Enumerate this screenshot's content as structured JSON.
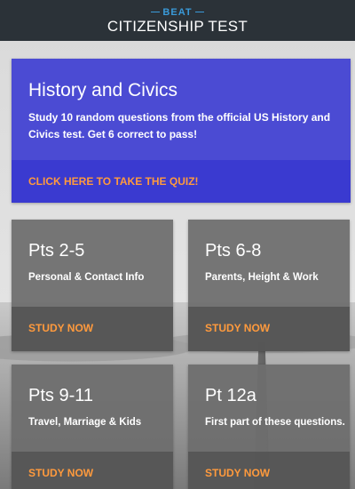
{
  "header": {
    "brand": "BEAT",
    "title": "CITIZENSHIP TEST"
  },
  "hero": {
    "title": "History and Civics",
    "description": "Study 10 random questions from the official US History and Civics test. Get 6 correct to pass!",
    "action": "CLICK HERE TO TAKE THE QUIZ!"
  },
  "cards": [
    {
      "title": "Pts 2-5",
      "subtitle": "Personal & Contact Info",
      "action": "STUDY NOW"
    },
    {
      "title": "Pts 6-8",
      "subtitle": "Parents, Height & Work",
      "action": "STUDY NOW"
    },
    {
      "title": "Pts 9-11",
      "subtitle": "Travel, Marriage & Kids",
      "action": "STUDY NOW"
    },
    {
      "title": "Pt 12a",
      "subtitle": "First part of these questions.",
      "action": "STUDY NOW"
    }
  ],
  "colors": {
    "header_bg": "#2b3238",
    "brand_accent": "#3a9ad9",
    "hero_bg": "#4b4bd3",
    "action_text": "#ff9a3d"
  }
}
